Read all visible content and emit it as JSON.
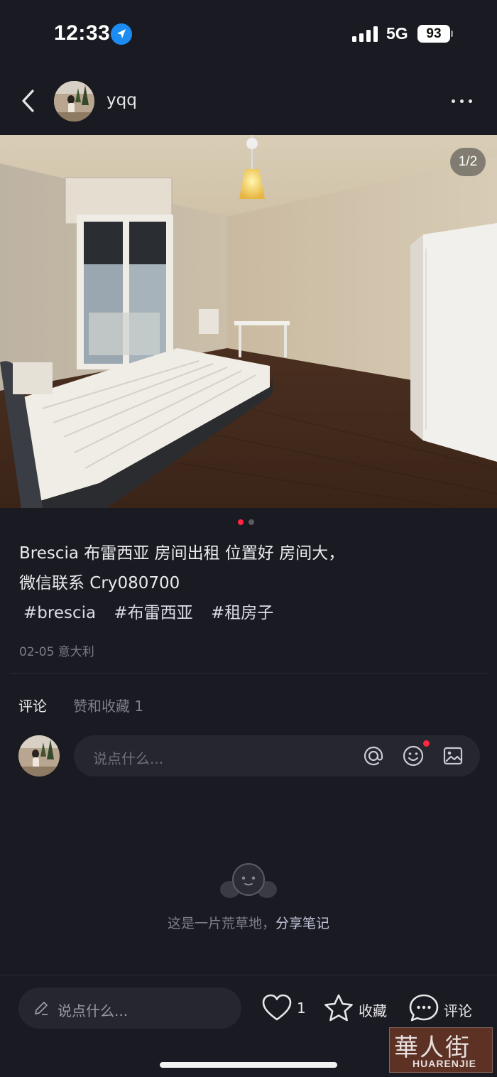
{
  "status_bar": {
    "time": "12:33",
    "network": "5G",
    "battery": "93",
    "icons": [
      "location-arrow-icon",
      "signal-bars-icon",
      "battery-icon"
    ]
  },
  "header": {
    "username": "yqq",
    "icons": [
      "chevron-left-icon",
      "avatar",
      "more-dots-icon"
    ]
  },
  "photo": {
    "page_counter": "1/2",
    "current_page": 1,
    "total_pages": 2,
    "indicator_active_color": "#ff2741",
    "indicator_inactive_color": "#5a5b63"
  },
  "post": {
    "line1": "Brescia 布雷西亚 房间出租 位置好 房间大，",
    "line2": "微信联系 Cry080700",
    "tags": [
      "#brescia",
      "#布雷西亚",
      "#租房子"
    ],
    "date_location": "02-05 意大利"
  },
  "comments": {
    "tab_comments": "评论",
    "tab_likes": "赞和收藏 1",
    "input_placeholder": "说点什么...",
    "input_icons": [
      "at-icon",
      "emoji-icon",
      "image-icon"
    ],
    "empty_text": "这是一片荒草地，",
    "empty_link": "分享笔记"
  },
  "bottom_bar": {
    "input_placeholder": "说点什么...",
    "like_count": "1",
    "collect_label": "收藏",
    "comment_label": "评论",
    "icons": [
      "pencil-icon",
      "heart-icon",
      "star-icon",
      "chat-bubble-icon"
    ]
  },
  "watermark": {
    "chinese": "華人街",
    "english": "HUARENJIE"
  }
}
